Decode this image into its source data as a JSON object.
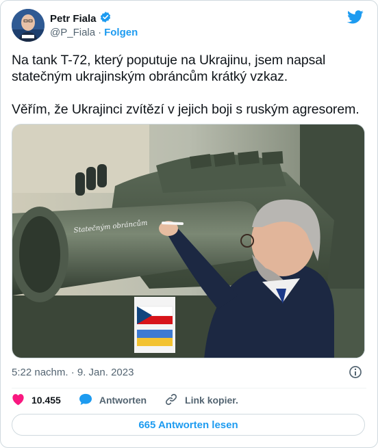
{
  "author": {
    "name": "Petr Fiala",
    "handle": "@P_Fiala",
    "separator": "·",
    "follow_label": "Folgen"
  },
  "tweet": {
    "paragraphs": [
      "Na tank T-72, který poputuje na Ukrajinu, jsem napsal statečným ukrajinským obráncům krátký vzkaz.",
      "Věřím, že Ukrajinci zvítězí v jejich boji s ruským agresorem."
    ],
    "timestamp": "5:22 nachm. · 9. Jan. 2023"
  },
  "media": {
    "tank_inscription": "Statečným obráncům"
  },
  "actions": {
    "likes": "10.455",
    "reply_label": "Antworten",
    "copy_link_label": "Link kopier."
  },
  "read_replies_label": "665 Antworten lesen",
  "colors": {
    "accent": "#1d9bf0",
    "like": "#f91880",
    "muted": "#536471",
    "border": "#cfd9de"
  },
  "icons": {
    "brand": "twitter-bird-icon",
    "verified": "verified-badge-icon",
    "like": "heart-icon",
    "reply": "speech-bubble-icon",
    "link": "link-icon",
    "info": "info-icon"
  }
}
